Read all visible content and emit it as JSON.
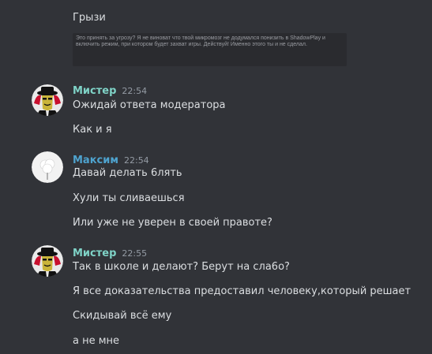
{
  "colors": {
    "background": "#313338",
    "text": "#dbdee1",
    "timestamp": "#949ba4",
    "username_mister": "#7fd3c7",
    "username_maksim": "#4ea3cf"
  },
  "prev_group": {
    "lines": [
      "Грызи"
    ],
    "embed_text": "Это принять за угрозу? Я не виноват что твой микромозг не додумался понизить в ShadowPlay и включить режим, при котором будет захват игры. Действуй! Именно этого ты и не сделал."
  },
  "messages": [
    {
      "author": "Мистер",
      "avatar_icon": "mister-avatar-icon",
      "time": "22:54",
      "lines": [
        "Ожидай ответа модератора",
        "Как и я"
      ]
    },
    {
      "author": "Максим",
      "avatar_icon": "maksim-avatar-icon",
      "time": "22:54",
      "lines": [
        "Давай делать 6лять",
        "Хули ты сливаешься",
        "Или уже не уверен в своей правоте?"
      ]
    },
    {
      "author": "Мистер",
      "avatar_icon": "mister-avatar-icon",
      "time": "22:55",
      "lines": [
        "Так в школе и делают? Берут на сла6о?",
        "Я все доказательства предоставил человеку,который решает",
        "Скидывай всё ему",
        "а не мне"
      ]
    }
  ]
}
